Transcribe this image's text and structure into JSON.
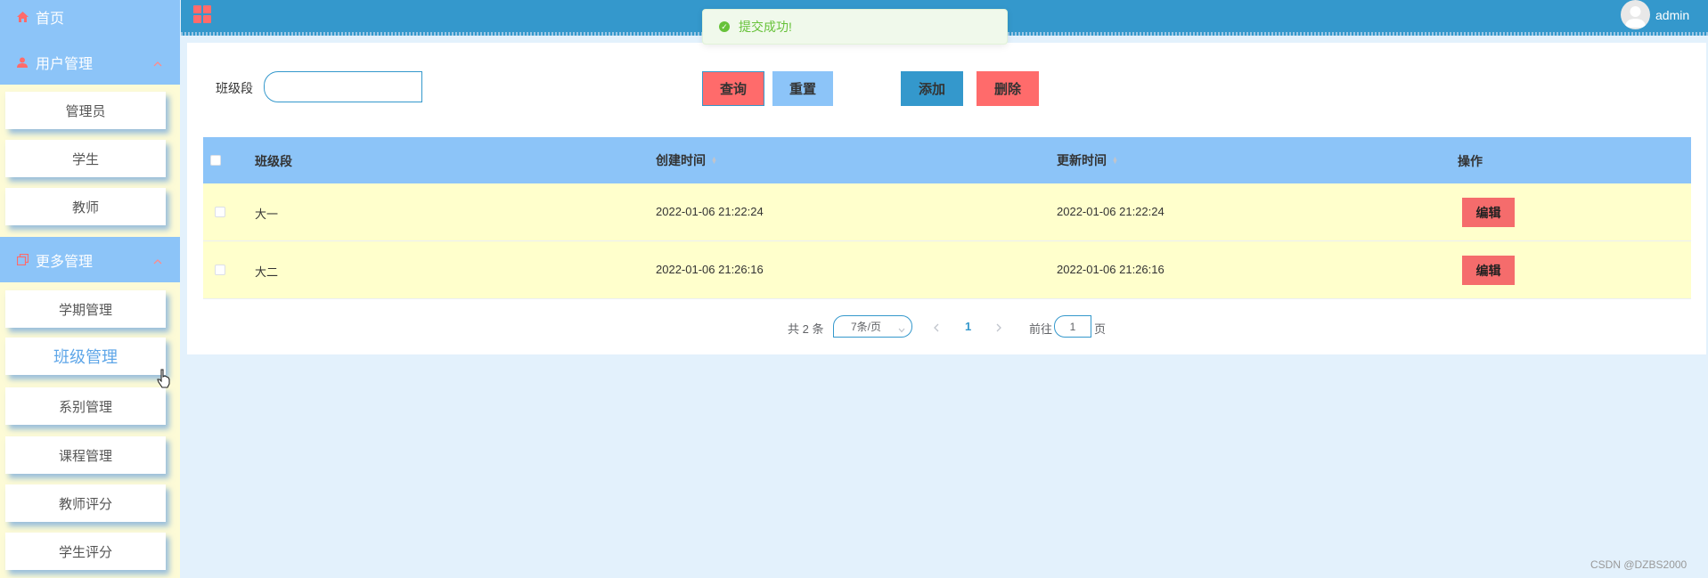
{
  "sidebar": {
    "home": "首页",
    "user_mgmt": "用户管理",
    "user_items": [
      "管理员",
      "学生",
      "教师"
    ],
    "more_mgmt": "更多管理",
    "more_items": [
      "学期管理",
      "班级管理",
      "系别管理",
      "课程管理",
      "教师评分",
      "学生评分"
    ],
    "active_item": "班级管理"
  },
  "header": {
    "username": "admin",
    "menu_icon": "grid-icon",
    "avatar_icon": "user-avatar-icon"
  },
  "toast": {
    "message": "提交成功!"
  },
  "filter": {
    "label": "班级段",
    "value": "",
    "query_label": "查询",
    "reset_label": "重置",
    "add_label": "添加",
    "delete_label": "删除"
  },
  "table": {
    "columns": [
      "班级段",
      "创建时间",
      "更新时间",
      "操作"
    ],
    "rows": [
      {
        "name": "大一",
        "created": "2022-01-06 21:22:24",
        "updated": "2022-01-06 21:22:24",
        "action": "编辑"
      },
      {
        "name": "大二",
        "created": "2022-01-06 21:26:16",
        "updated": "2022-01-06 21:26:16",
        "action": "编辑"
      }
    ]
  },
  "pagination": {
    "total": "共 2 条",
    "page_size": "7条/页",
    "current_page": "1",
    "goto_prefix": "前往",
    "goto_value": "1",
    "goto_suffix": "页"
  },
  "watermark": "CSDN @DZBS2000",
  "colors": {
    "sidebar_header": "#8cc4f8",
    "topbar": "#3498cc",
    "table_header": "#8cc4f8",
    "row_bg": "#ffffcc",
    "danger": "#ff6b6b",
    "primary": "#3498cc",
    "light_blue": "#8cc4f8",
    "success": "#67c23a"
  }
}
